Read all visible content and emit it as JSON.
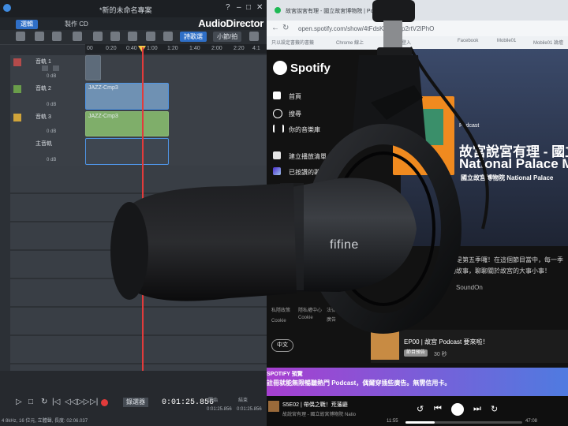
{
  "audio_director": {
    "window_title": "*新的未命名專案",
    "brand": "AudioDirector",
    "tabs": [
      {
        "label": "選輯",
        "active": true
      },
      {
        "label": "製作 CD",
        "active": false
      }
    ],
    "modes": [
      "詩歌選",
      "小節/拍"
    ],
    "ruler_ticks": [
      "00",
      "0:20",
      "0:40",
      "1:00",
      "1:20",
      "1:40",
      "2:00",
      "2:20",
      "4:1"
    ],
    "tracks": [
      {
        "name": "音軌 1",
        "volume": "0 dB",
        "clip": ""
      },
      {
        "name": "音軌 2",
        "volume": "0 dB",
        "clip": "JAZZ-Cmp3"
      },
      {
        "name": "音軌 3",
        "volume": "0 dB",
        "clip": "JAZZ-Cmp3"
      },
      {
        "name": "主音軌",
        "volume": "0 dB",
        "clip": ""
      }
    ],
    "bottom": {
      "timecode": "0:01:25.856",
      "status": "4 8kHz, 16 位元, 立體聲, 長度: 02:06.037",
      "start_label": "開始",
      "end_label": "結束",
      "start_time": "0:01:25.856",
      "end_time": "0:01:25.856",
      "select_label": "錄選器"
    }
  },
  "browser": {
    "tab_title": "故宮說宮有理 - 國立故宮博物院 | Podcast on Spotify",
    "url": "open.spotify.com/show/4tFdsKiE0lkEp2rtV2lPhO",
    "bookmarks": [
      "只以設定書籤的書籤",
      "Chrome 線上",
      "Google 登入",
      "Facebook",
      "Mobile01",
      "Mobile01 論壇"
    ]
  },
  "spotify": {
    "logo": "Spotify",
    "nav": [
      "首頁",
      "搜尋",
      "你的音樂庫"
    ],
    "library": [
      "建立播放清單",
      "已按讚的歌曲"
    ],
    "podcast_label": "Podcast",
    "podcast_title": "故宮說宮有理 - 國立",
    "podcast_title_en": "National Palace M",
    "publisher": "國立故宮博物院 National Palace",
    "description_1": "已經是第五季囉！在這個節目當中，每一季",
    "description_2": "文物故事，聊聊關於故宮的大事小事！",
    "by": "SoundOn",
    "legal": [
      "私隱政策",
      "隱私權中心",
      "法律",
      "Cookie",
      "廣告"
    ],
    "legal_2": "Cookie",
    "language": "中文",
    "episode": {
      "title": "EP00 | 故宮 Podcast 要來啦！",
      "tag": "節目預告",
      "length": "30 秒"
    },
    "banner_head": "SPOTIFY 預覽",
    "banner_text": "註冊就能無限暢聽熱門 Podcast，偶爾穿插些廣告。無需信用卡。",
    "now_playing": {
      "title": "S5E02 | 帶偶之戰！荒藩廳",
      "subtitle": "故說宮有理 - 國立故宮博物院 Natio",
      "time_current": "11:55",
      "time_total": "47:08"
    }
  },
  "microphone": {
    "brand": "fifine"
  }
}
